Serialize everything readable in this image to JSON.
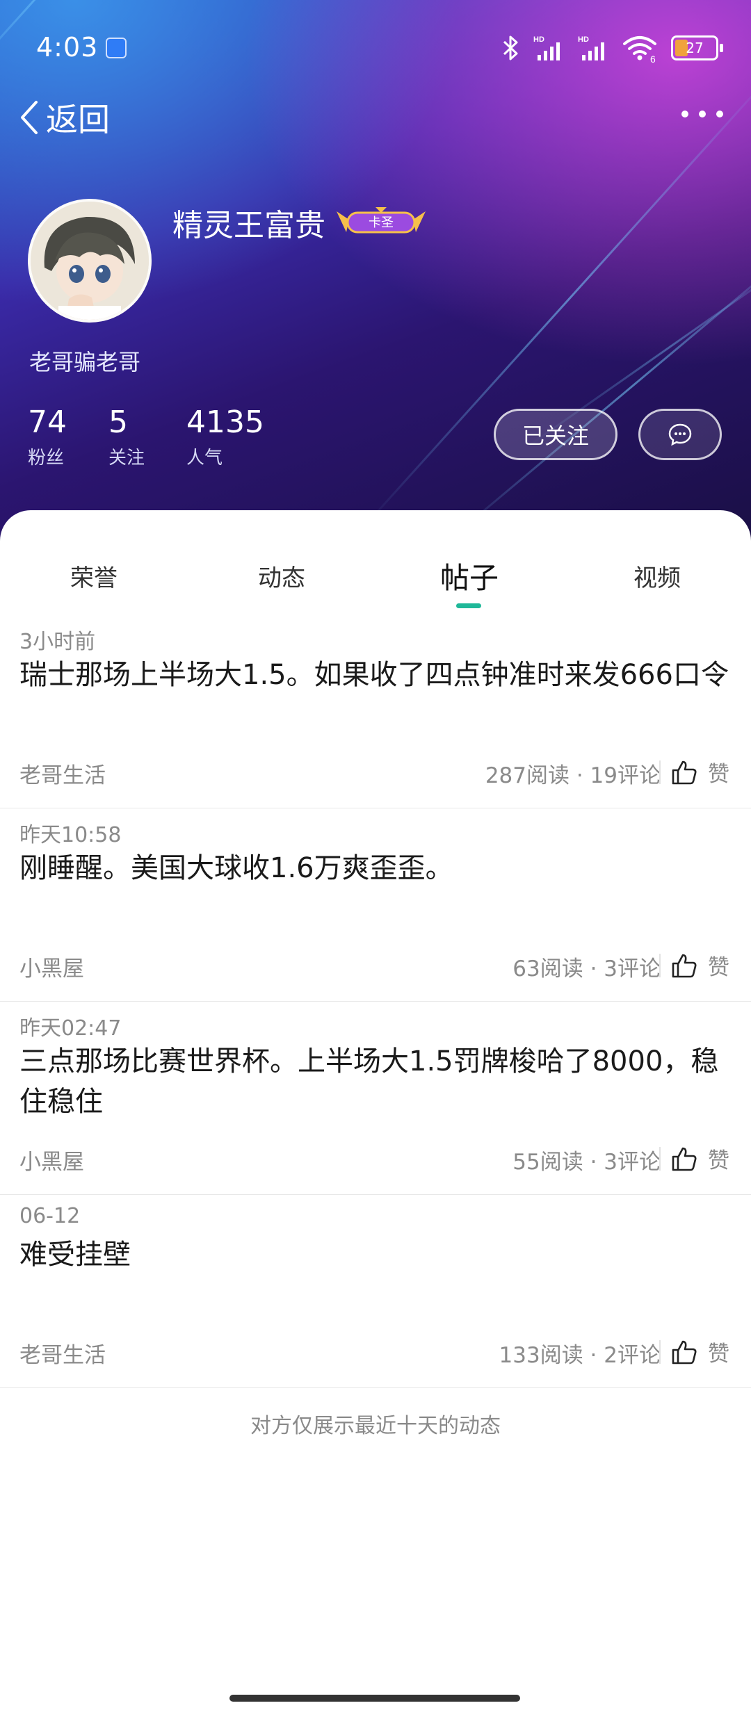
{
  "status_bar": {
    "time": "4:03",
    "hd_label": "HD",
    "wifi_label": "6",
    "battery_level": "27"
  },
  "nav": {
    "back_label": "返回"
  },
  "profile": {
    "name": "精灵王富贵",
    "badge_text": "卡圣",
    "signature": "老哥骗老哥",
    "stats": [
      {
        "value": "74",
        "label": "粉丝"
      },
      {
        "value": "5",
        "label": "关注"
      },
      {
        "value": "4135",
        "label": "人气"
      }
    ],
    "follow_button": "已关注"
  },
  "tabs": [
    {
      "label": "荣誉"
    },
    {
      "label": "动态"
    },
    {
      "label": "帖子"
    },
    {
      "label": "视频"
    }
  ],
  "active_tab": "帖子",
  "posts": [
    {
      "time": "3小时前",
      "text": "瑞士那场上半场大1.5。如果收了四点钟准时来发666口令",
      "circle": "老哥生活",
      "meta": "287阅读 · 19评论",
      "like": "赞"
    },
    {
      "time": "昨天10:58",
      "text": "刚睡醒。美国大球收1.6万爽歪歪。",
      "circle": "小黑屋",
      "meta": "63阅读 · 3评论",
      "like": "赞"
    },
    {
      "time": "昨天02:47",
      "text": "三点那场比赛世界杯。上半场大1.5罚牌梭哈了8000，稳住稳住",
      "circle": "小黑屋",
      "meta": "55阅读 · 3评论",
      "like": "赞"
    },
    {
      "time": "06-12",
      "text": "难受挂壁",
      "circle": "老哥生活",
      "meta": "133阅读 · 2评论",
      "like": "赞"
    }
  ],
  "footer_note": "对方仅展示最近十天的动态",
  "colors": {
    "accent": "#1fb899",
    "header_dark": "#1a0f45",
    "header_purple": "#3a2aa8"
  }
}
